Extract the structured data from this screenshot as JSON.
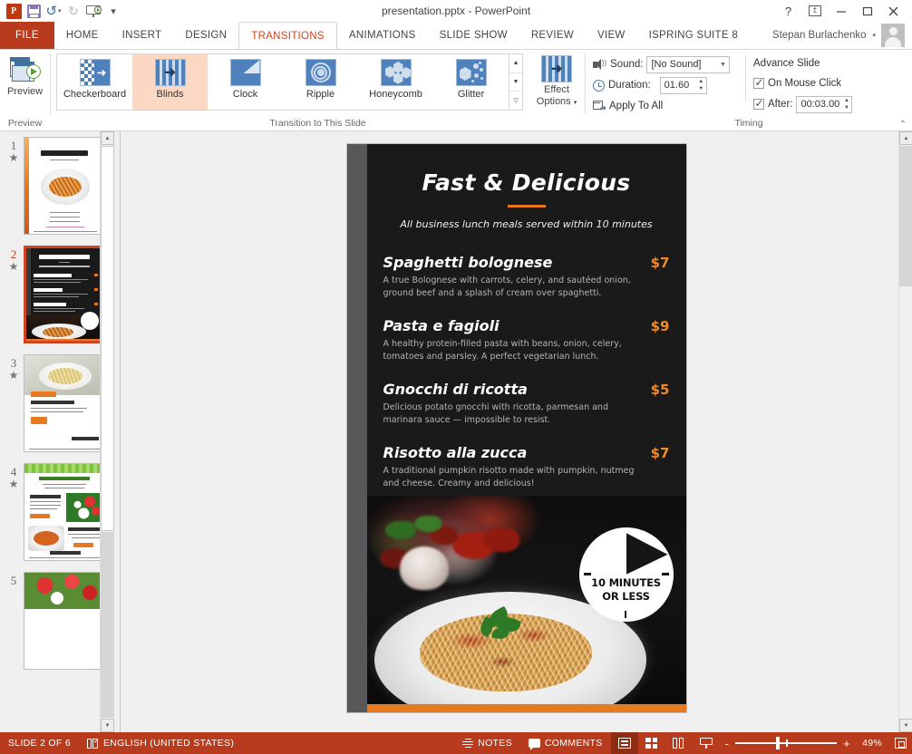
{
  "window": {
    "title": "presentation.pptx - PowerPoint",
    "quick_access": [
      {
        "name": "powerpoint-logo",
        "label": "P"
      },
      {
        "name": "save-icon",
        "label": "Save"
      },
      {
        "name": "undo-icon",
        "label": "Undo"
      },
      {
        "name": "redo-icon",
        "label": "Redo"
      },
      {
        "name": "start-slideshow-icon",
        "label": "Start From Beginning"
      },
      {
        "name": "customize-qat-icon",
        "label": "Customize Quick Access Toolbar"
      }
    ],
    "controls": {
      "help": "?",
      "ribbon_display": "Ribbon Display Options",
      "minimize": "Minimize",
      "restore": "Restore Down",
      "close": "Close"
    }
  },
  "ribbon": {
    "file_tab": "FILE",
    "tabs": [
      {
        "label": "HOME",
        "active": false
      },
      {
        "label": "INSERT",
        "active": false
      },
      {
        "label": "DESIGN",
        "active": false
      },
      {
        "label": "TRANSITIONS",
        "active": true
      },
      {
        "label": "ANIMATIONS",
        "active": false
      },
      {
        "label": "SLIDE SHOW",
        "active": false
      },
      {
        "label": "REVIEW",
        "active": false
      },
      {
        "label": "VIEW",
        "active": false
      },
      {
        "label": "ISPRING SUITE 8",
        "active": false
      }
    ],
    "user": "Stepan Burlachenko",
    "groups": {
      "preview": {
        "label": "Preview",
        "button_label": "Preview"
      },
      "transition": {
        "label": "Transition to This Slide",
        "items": [
          {
            "label": "Checkerboard",
            "selected": false
          },
          {
            "label": "Blinds",
            "selected": true
          },
          {
            "label": "Clock",
            "selected": false
          },
          {
            "label": "Ripple",
            "selected": false
          },
          {
            "label": "Honeycomb",
            "selected": false
          },
          {
            "label": "Glitter",
            "selected": false
          }
        ],
        "effect_options_label": "Effect\nOptions"
      },
      "timing": {
        "label": "Timing",
        "sound_label": "Sound:",
        "sound_value": "[No Sound]",
        "duration_label": "Duration:",
        "duration_value": "01.60",
        "apply_to_all_label": "Apply To All",
        "advance_slide_label": "Advance Slide",
        "on_mouse_click_label": "On Mouse Click",
        "on_mouse_click_checked": true,
        "after_label": "After:",
        "after_value": "00:03.00",
        "after_checked": true
      }
    }
  },
  "thumbnails": {
    "slides": [
      {
        "number": "1",
        "has_transition": true,
        "selected": false
      },
      {
        "number": "2",
        "has_transition": true,
        "selected": true
      },
      {
        "number": "3",
        "has_transition": true,
        "selected": false
      },
      {
        "number": "4",
        "has_transition": true,
        "selected": false
      },
      {
        "number": "5",
        "has_transition": false,
        "selected": false
      }
    ]
  },
  "slide": {
    "title": "Fast & Delicious",
    "subtitle": "All business lunch meals served within 10 minutes",
    "accent_color": "#e8791e",
    "price_color": "#f08a2a",
    "background_color": "#1a1a1a",
    "menu": [
      {
        "name": "Spaghetti bolognese",
        "price": "$7",
        "description": "A true Bolognese with carrots, celery, and sautéed onion, ground beef and a splash of cream over spaghetti."
      },
      {
        "name": "Pasta e fagioli",
        "price": "$9",
        "description": "A healthy protein-filled pasta with beans, onion, celery, tomatoes and parsley. A perfect vegetarian lunch."
      },
      {
        "name": "Gnocchi di ricotta",
        "price": "$5",
        "description": "Delicious potato gnocchi with ricotta, parmesan and marinara sauce — impossible to resist."
      },
      {
        "name": "Risotto alla zucca",
        "price": "$7",
        "description": "A traditional pumpkin risotto made with pumpkin, nutmeg and cheese. Creamy and delicious!"
      }
    ],
    "badge": {
      "line1": "10 MINUTES",
      "line2": "OR LESS"
    }
  },
  "status_bar": {
    "slide_count": "SLIDE 2 OF 6",
    "language": "ENGLISH (UNITED STATES)",
    "notes": "NOTES",
    "comments": "COMMENTS",
    "views": [
      {
        "name": "normal",
        "active": true
      },
      {
        "name": "slide-sorter",
        "active": false
      },
      {
        "name": "reading-view",
        "active": false
      },
      {
        "name": "slide-show",
        "active": false
      }
    ],
    "zoom_out": "-",
    "zoom_in": "+",
    "zoom_level": "49%"
  }
}
